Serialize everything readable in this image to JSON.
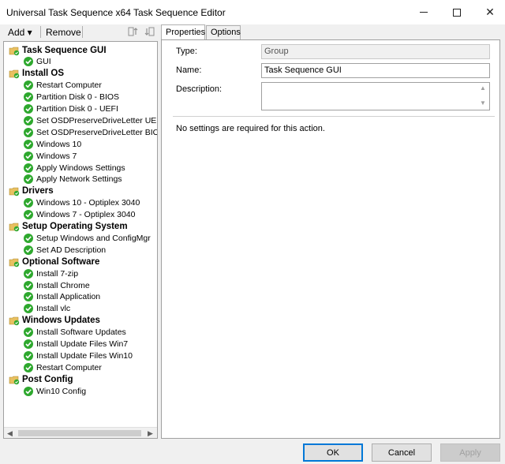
{
  "window": {
    "title": "Universal Task Sequence x64 Task Sequence Editor"
  },
  "toolbar": {
    "add_label": "Add ▾",
    "remove_label": "Remove"
  },
  "tree": {
    "groups": [
      {
        "label": "Task Sequence GUI",
        "steps": [
          "GUI"
        ]
      },
      {
        "label": "Install OS",
        "steps": [
          "Restart Computer",
          "Partition Disk 0 - BIOS",
          "Partition Disk 0 - UEFI",
          "Set OSDPreserveDriveLetter UEFI",
          "Set OSDPreserveDriveLetter BIOS",
          "Windows 10",
          "Windows 7",
          "Apply Windows Settings",
          "Apply Network Settings"
        ]
      },
      {
        "label": "Drivers",
        "steps": [
          "Windows 10 - Optiplex 3040",
          "Windows 7 - Optiplex 3040"
        ]
      },
      {
        "label": "Setup Operating System",
        "steps": [
          "Setup Windows and ConfigMgr",
          "Set AD Description"
        ]
      },
      {
        "label": "Optional Software",
        "steps": [
          "Install 7-zip",
          "Install Chrome",
          "Install Application",
          "Install vlc"
        ]
      },
      {
        "label": "Windows Updates",
        "steps": [
          "Install Software Updates",
          "Install Update Files Win7",
          "Install Update Files Win10",
          "Restart Computer"
        ]
      },
      {
        "label": "Post Config",
        "steps": [
          "Win10 Config"
        ]
      }
    ]
  },
  "tabs": {
    "properties": "Properties",
    "options": "Options"
  },
  "properties": {
    "type_label": "Type:",
    "type_value": "Group",
    "name_label": "Name:",
    "name_value": "Task Sequence GUI",
    "description_label": "Description:",
    "description_value": "",
    "no_settings_text": "No settings are required  for this action."
  },
  "buttons": {
    "ok": "OK",
    "cancel": "Cancel",
    "apply": "Apply"
  },
  "colors": {
    "folder": "#e8c060",
    "check_green": "#2ea82e",
    "accent": "#0078d7"
  }
}
